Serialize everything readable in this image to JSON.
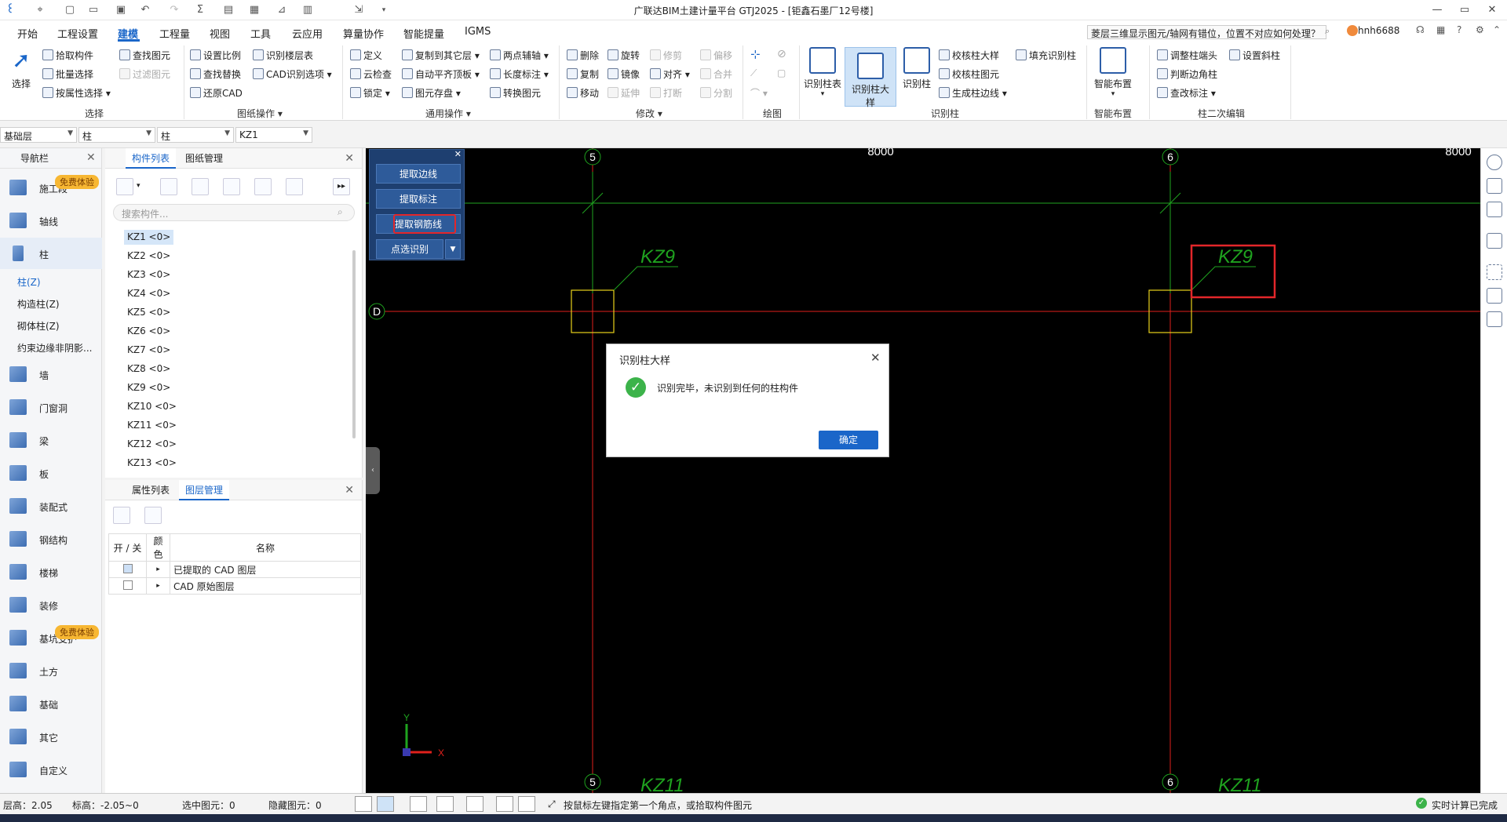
{
  "window": {
    "title": "广联达BIM土建计量平台 GTJ2025 - [钜鑫石墨厂12号楼]",
    "controls": [
      "—",
      "▭",
      "✕"
    ]
  },
  "menu": {
    "items": [
      "开始",
      "工程设置",
      "建模",
      "工程量",
      "视图",
      "工具",
      "云应用",
      "算量协作",
      "智能提量",
      "IGMS"
    ],
    "active_index": 2,
    "hint_search": "菱层三维显示图元/轴网有错位，位置不对应如何处理？",
    "user": "hnh6688"
  },
  "ribbon": {
    "select": {
      "big": "选择",
      "items": [
        "拾取构件",
        "批量选择",
        "按属性选择"
      ],
      "dis": [
        "查找图元",
        "过滤图元"
      ],
      "label": "选择"
    },
    "drawing": {
      "items": [
        "设置比例",
        "查找替换",
        "还原CAD",
        "识别楼层表",
        "CAD识别选项"
      ],
      "label": "图纸操作"
    },
    "common": {
      "items": [
        "定义",
        "云检查",
        "锁定",
        "复制到其它层",
        "自动平齐顶板",
        "图元存盘",
        "两点辅轴",
        "长度标注",
        "转换图元"
      ],
      "label": "通用操作"
    },
    "modify": {
      "items": [
        "删除",
        "复制",
        "移动",
        "旋转",
        "镜像",
        "对齐"
      ],
      "dis": [
        "修剪",
        "延伸",
        "打断",
        "偏移",
        "合并",
        "分割"
      ],
      "label": "修改"
    },
    "draw": {
      "label": "绘图"
    },
    "recognize": {
      "big": [
        "识别柱表",
        "识别柱大样",
        "识别柱"
      ],
      "items": [
        "校核柱大样",
        "校核柱图元",
        "生成柱边线",
        "填充识别柱"
      ],
      "label": "识别柱"
    },
    "smart": {
      "big": "智能布置",
      "label": "智能布置"
    },
    "edit2": {
      "items": [
        "调整柱端头",
        "判断边角柱",
        "查改标注",
        "设置斜柱"
      ],
      "label": "柱二次编辑"
    }
  },
  "selectors": [
    "基础层",
    "柱",
    "柱",
    "KZ1"
  ],
  "nav": {
    "title": "导航栏",
    "items": [
      "施工段",
      "轴线",
      "柱",
      "墙",
      "门窗洞",
      "梁",
      "板",
      "装配式",
      "钢结构",
      "楼梯",
      "装修",
      "基坑支护",
      "土方",
      "基础",
      "其它",
      "自定义"
    ],
    "sub": [
      "柱(Z)",
      "构造柱(Z)",
      "砌体柱(Z)",
      "约束边缘非阴影..."
    ],
    "badge": "免费体验"
  },
  "components": {
    "tabs": [
      "构件列表",
      "图纸管理"
    ],
    "search_placeholder": "搜索构件...",
    "list": [
      "KZ1 <0>",
      "KZ2 <0>",
      "KZ3 <0>",
      "KZ4 <0>",
      "KZ5 <0>",
      "KZ6 <0>",
      "KZ7 <0>",
      "KZ8 <0>",
      "KZ9 <0>",
      "KZ10 <0>",
      "KZ11 <0>",
      "KZ12 <0>",
      "KZ13 <0>"
    ]
  },
  "layers": {
    "tabs": [
      "属性列表",
      "图层管理"
    ],
    "headers": [
      "开 / 关",
      "颜色",
      "名称"
    ],
    "rows": [
      "已提取的 CAD 图层",
      "CAD 原始图层"
    ]
  },
  "float_panel": {
    "buttons": [
      "提取边线",
      "提取标注",
      "提取钢筋线",
      "点选识别"
    ]
  },
  "canvas": {
    "axis_top": [
      "5",
      "6"
    ],
    "axis_left": "D",
    "dims": [
      "8000",
      "8000"
    ],
    "labels": [
      "KZ9",
      "KZ9",
      "KZ11",
      "KZ11"
    ],
    "coord": [
      "Y",
      "X"
    ]
  },
  "dialog": {
    "title": "识别柱大样",
    "message": "识别完毕，未识别到任何的柱构件",
    "ok": "确定"
  },
  "status": {
    "floor_height": "层高：2.05",
    "elevation": "标高：-2.05~0",
    "selected": "选中图元：0",
    "hidden": "隐藏图元：0",
    "prompt": "按鼠标左键指定第一个角点，或拾取构件图元",
    "realtime": "实时计算已完成"
  },
  "colors": {
    "accent": "#1a66c9",
    "axis_green": "#1fa31f",
    "axis_red": "#e0201c",
    "highlight": "#e3262a"
  }
}
